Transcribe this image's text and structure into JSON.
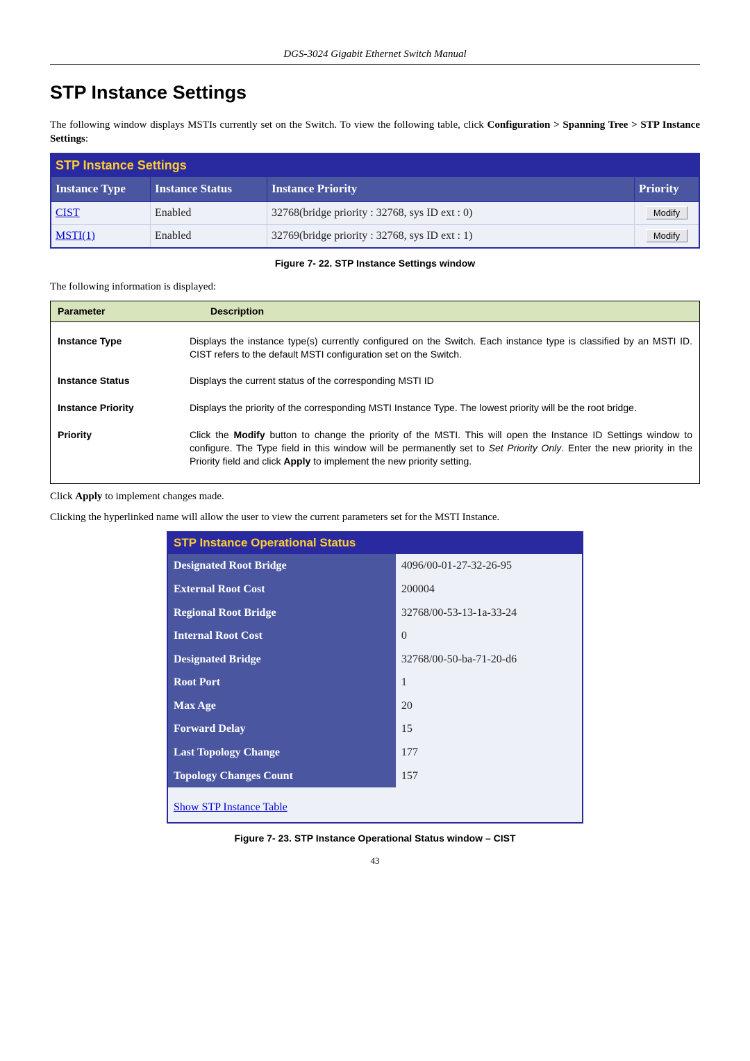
{
  "header": "DGS-3024 Gigabit Ethernet Switch Manual",
  "section_title": "STP Instance Settings",
  "intro_prefix": "The following window displays MSTIs currently set on the Switch. To view the following table, click ",
  "intro_bold": "Configuration > Spanning Tree > STP Instance Settings",
  "intro_colon": ":",
  "fig22_caption": "Figure 7- 22. STP Instance Settings window",
  "stp_window": {
    "title": "STP Instance Settings",
    "headers": {
      "type": "Instance Type",
      "status": "Instance Status",
      "priority_long": "Instance Priority",
      "priority_short": "Priority"
    },
    "rows": [
      {
        "type": "CIST",
        "status": "Enabled",
        "priority": "32768(bridge priority : 32768, sys ID ext : 0)",
        "btn": "Modify"
      },
      {
        "type": "MSTI(1)",
        "status": "Enabled",
        "priority": "32769(bridge priority : 32768, sys ID ext : 1)",
        "btn": "Modify"
      }
    ]
  },
  "between_text": "The following information is displayed:",
  "param_table": {
    "head_param": "Parameter",
    "head_desc": "Description",
    "rows": [
      {
        "name": "Instance Type",
        "desc": "Displays the instance type(s) currently configured on the Switch. Each instance type is classified by an MSTI ID. CIST refers to the default MSTI configuration set on the Switch."
      },
      {
        "name": "Instance Status",
        "desc": "Displays the current status of the corresponding MSTI ID"
      },
      {
        "name": "Instance Priority",
        "desc": "Displays the priority of the corresponding MSTI Instance Type. The lowest priority will be the root bridge."
      }
    ],
    "priority_row": {
      "name": "Priority",
      "d1": "Click the ",
      "d2_bold": "Modify",
      "d3": " button to change the priority of the MSTI. This will open the Instance ID Settings window to configure. The Type field in this window will be permanently set to ",
      "d4_italic": "Set Priority Only",
      "d5": ". Enter the new priority in the Priority field and click ",
      "d6_bold": "Apply",
      "d7": " to implement the new priority setting."
    }
  },
  "apply_line_prefix": "Click ",
  "apply_line_bold": "Apply",
  "apply_line_suffix": " to implement changes made.",
  "hyperlink_line": "Clicking the hyperlinked name will allow the user to view the current parameters set for the MSTI Instance.",
  "op_window": {
    "title": "STP Instance Operational Status",
    "rows": [
      {
        "k": "Designated Root Bridge",
        "v": "4096/00-01-27-32-26-95"
      },
      {
        "k": "External Root Cost",
        "v": "200004"
      },
      {
        "k": "Regional Root Bridge",
        "v": "32768/00-53-13-1a-33-24"
      },
      {
        "k": "Internal Root Cost",
        "v": "0"
      },
      {
        "k": "Designated Bridge",
        "v": "32768/00-50-ba-71-20-d6"
      },
      {
        "k": "Root Port",
        "v": "1"
      },
      {
        "k": "Max Age",
        "v": "20"
      },
      {
        "k": "Forward Delay",
        "v": "15"
      },
      {
        "k": "Last Topology Change",
        "v": "177"
      },
      {
        "k": "Topology Changes Count",
        "v": "157"
      }
    ],
    "link": "Show STP Instance Table"
  },
  "fig23_caption": "Figure 7- 23. STP Instance Operational Status window – CIST",
  "page_number": "43"
}
